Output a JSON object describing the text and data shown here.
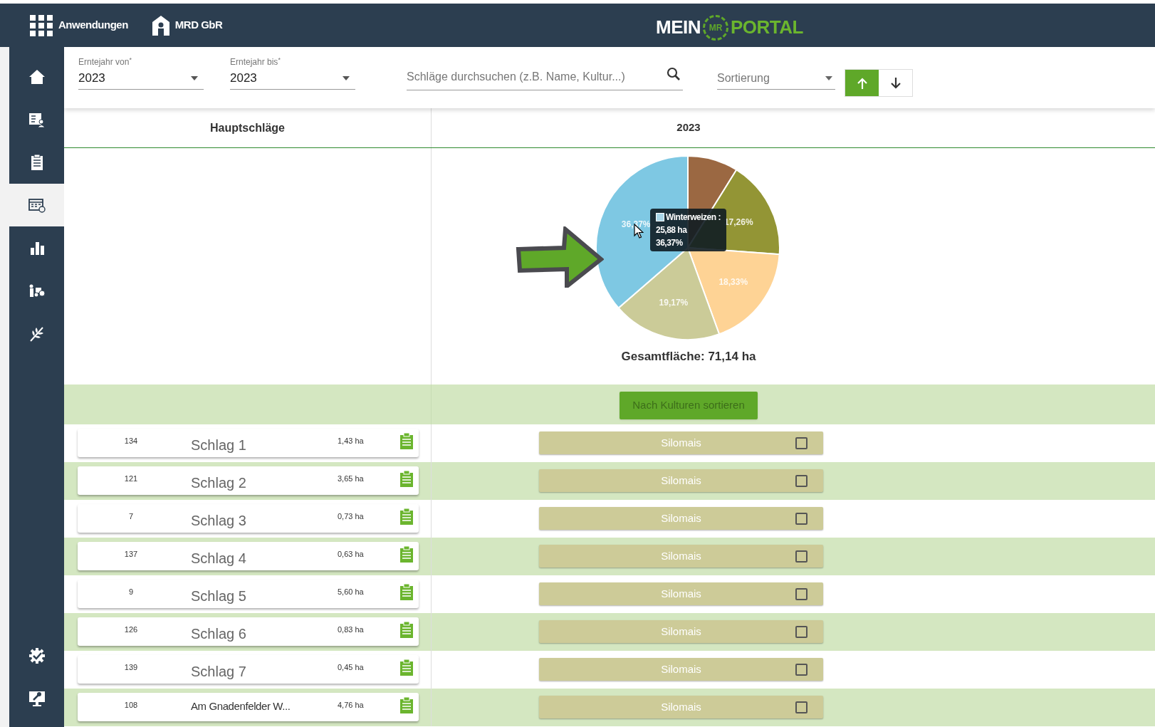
{
  "top_bar": {
    "apps_label": "Anwendungen",
    "company": "MRD GbR",
    "logo": {
      "left": "MEIN",
      "badge": "MR",
      "right": "PORTAL"
    }
  },
  "sidebar": {
    "items": [
      {
        "kind": "home",
        "selected": false
      },
      {
        "kind": "form",
        "selected": false
      },
      {
        "kind": "clipboard",
        "selected": false
      },
      {
        "kind": "calendar",
        "selected": true
      },
      {
        "kind": "chart",
        "selected": false
      },
      {
        "kind": "tractor",
        "selected": false
      },
      {
        "kind": "wheat",
        "selected": false
      }
    ],
    "bottom_items": [
      {
        "kind": "gear",
        "selected": false
      },
      {
        "kind": "monitor",
        "selected": false
      }
    ]
  },
  "filters": {
    "year_from": {
      "label": "Erntejahr von$^{*}$",
      "value": "2023"
    },
    "year_to": {
      "label": "Erntejahr bis$^{*}$",
      "value": "2023"
    },
    "search": {
      "placeholder": "Schläge durchsuchen (z.B. Name, Kultur...)"
    },
    "sort": {
      "placeholder": "Sortierung"
    },
    "sort_direction": [
      {
        "kind": "up",
        "selected": true
      },
      {
        "kind": "down",
        "selected": false
      }
    ]
  },
  "table": {
    "columns": [
      "Hauptschläge",
      "2023"
    ],
    "chart_data": {
      "type": "pie",
      "values": [
        8.87,
        17.26,
        18.33,
        19.17,
        36.37
      ],
      "colors": [
        "#9b6842",
        "#939535",
        "#fed395",
        "#cbcb98",
        "#7ec8e3"
      ],
      "value_labels": [
        null,
        "17,26%",
        "18,33%",
        "19,17%",
        "36,37%"
      ]
    },
    "tooltip": {
      "name": "Winterweizen :",
      "area": "25,88 ha",
      "percent": "36,37%"
    },
    "total": "Gesamtfläche: 71,14 ha",
    "sort_button": "Nach Kulturen sortieren",
    "rows": [
      {
        "number": "134",
        "name": "Schlag 1",
        "area": "1,43 ha",
        "crop": "Silomais",
        "checked": false
      },
      {
        "number": "121",
        "name": "Schlag 2",
        "area": "3,65 ha",
        "crop": "Silomais",
        "checked": false
      },
      {
        "number": "7",
        "name": "Schlag 3",
        "area": "0,73 ha",
        "crop": "Silomais",
        "checked": false
      },
      {
        "number": "137",
        "name": "Schlag 4",
        "area": "0,63 ha",
        "crop": "Silomais",
        "checked": false
      },
      {
        "number": "9",
        "name": "Schlag 5",
        "area": "5,60 ha",
        "crop": "Silomais",
        "checked": false
      },
      {
        "number": "126",
        "name": "Schlag 6",
        "area": "0,83 ha",
        "crop": "Silomais",
        "checked": false
      },
      {
        "number": "139",
        "name": "Schlag 7",
        "area": "0,45 ha",
        "crop": "Silomais",
        "checked": false
      },
      {
        "number": "108",
        "name": "Am Gnadenfelder W...",
        "area": "4,76 ha",
        "crop": "Silomais",
        "checked": false
      }
    ]
  }
}
